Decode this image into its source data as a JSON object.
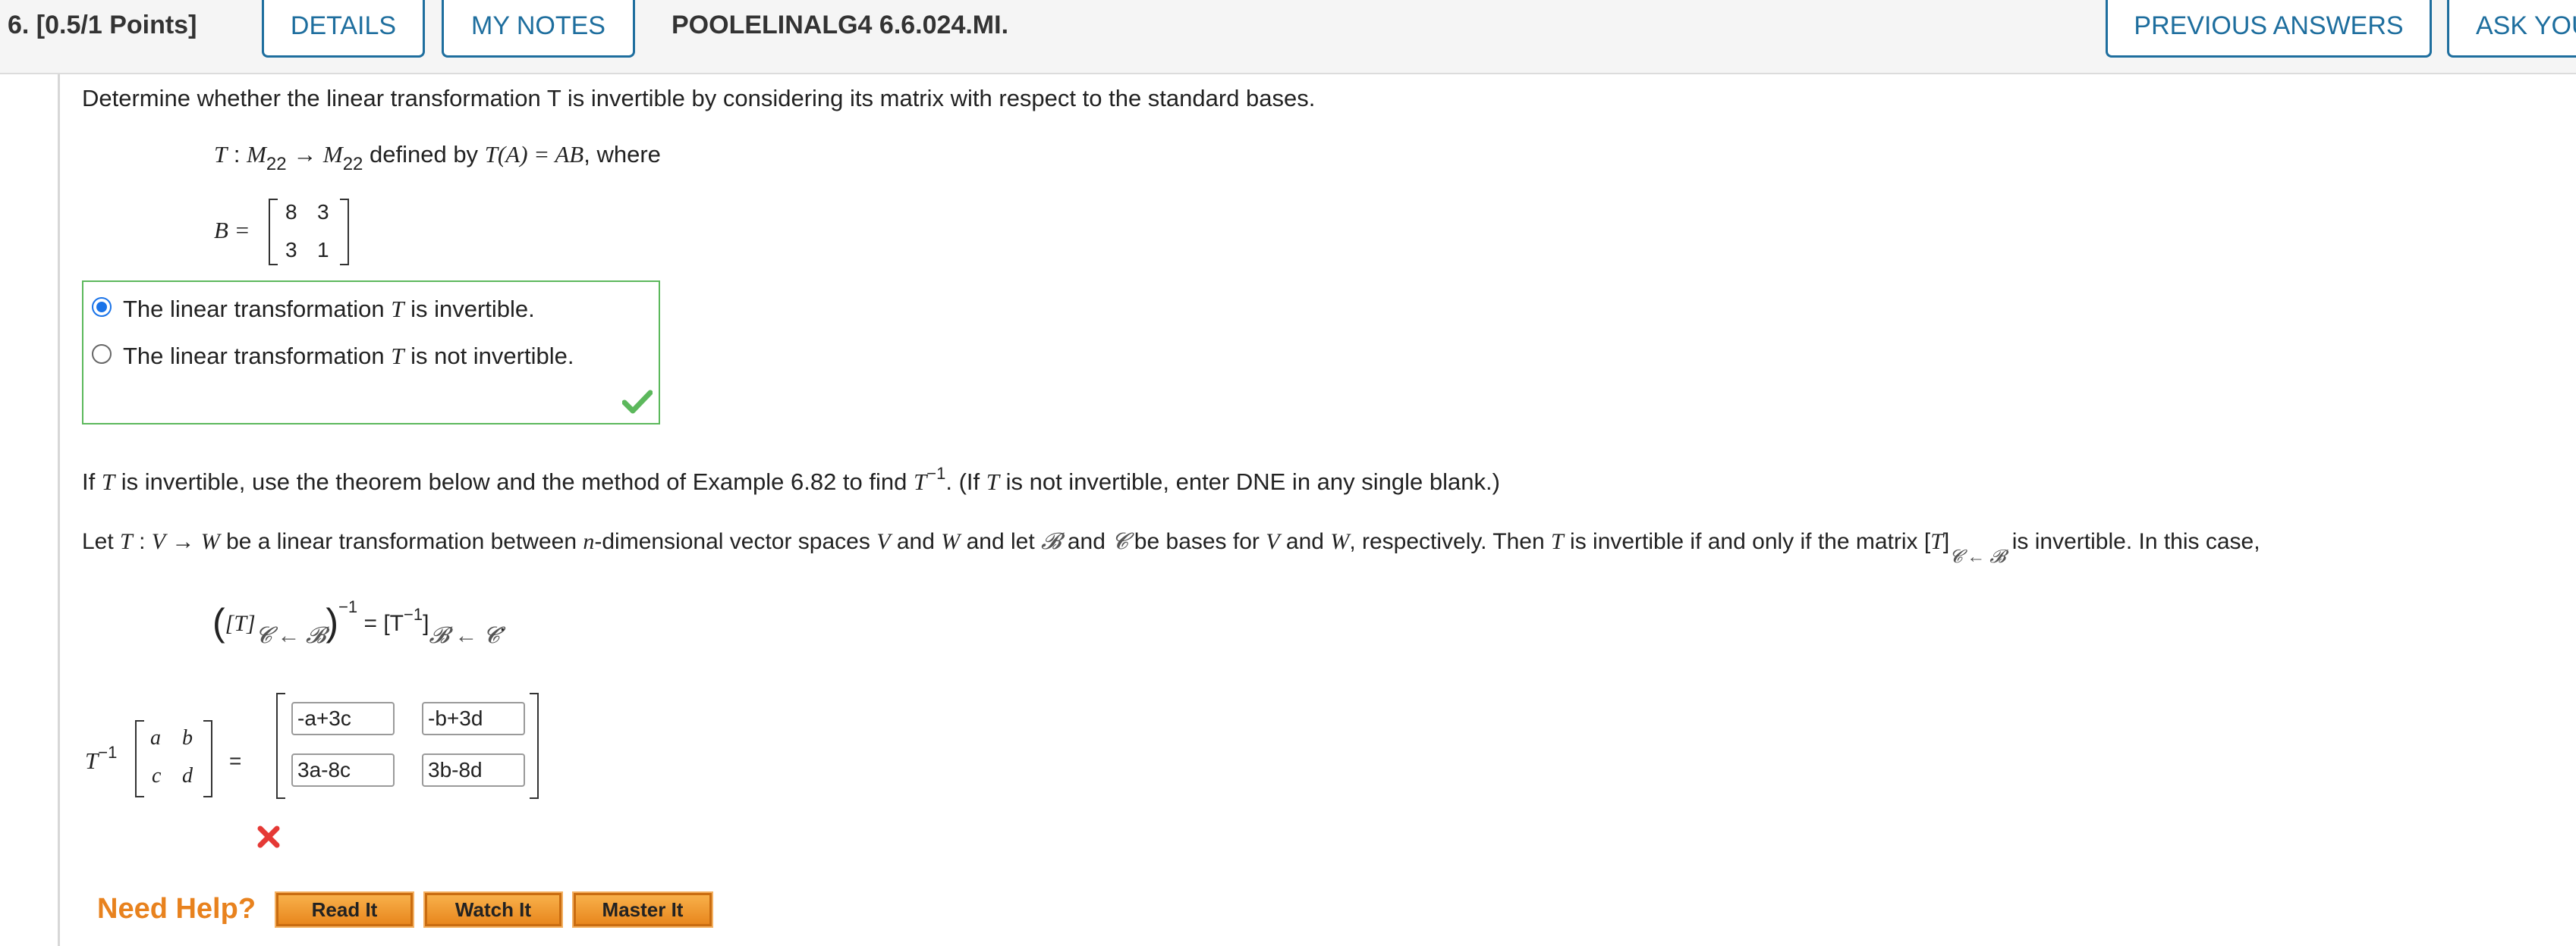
{
  "header": {
    "question_number": "6. [0.5/1 Points]",
    "details_label": "DETAILS",
    "my_notes_label": "MY NOTES",
    "problem_code": "POOLELINALG4 6.6.024.MI.",
    "previous_answers_label": "PREVIOUS ANSWERS",
    "ask_label": "ASK YOU"
  },
  "problem": {
    "intro": "Determine whether the linear transformation T is invertible by considering its matrix with respect to the standard bases.",
    "def_T": "T",
    "def_colon": " : ",
    "def_M1": "M",
    "def_sub1": "22",
    "def_arrow": " → ",
    "def_M2": "M",
    "def_sub2": "22",
    "def_text": " defined by ",
    "def_TA": "T(A) = AB",
    "def_where": ", where",
    "B_label": "B =",
    "matrix_B": [
      "8",
      "3",
      "3",
      "1"
    ]
  },
  "options": [
    {
      "prefix": "The linear transformation ",
      "var": "T",
      "suffix": " is invertible.",
      "selected": true
    },
    {
      "prefix": "The linear transformation ",
      "var": "T",
      "suffix": " is not invertible.",
      "selected": false
    }
  ],
  "part2": {
    "instruction_a": "If ",
    "instruction_T": "T",
    "instruction_b": " is invertible, use the theorem below and the method of Example 6.82 to find ",
    "instruction_Tinv": "T",
    "instruction_sup": "−1",
    "instruction_c": ". (If ",
    "instruction_T2": "T",
    "instruction_d": " is not invertible, enter DNE in any single blank.)",
    "theorem_a": "Let ",
    "theorem_T": "T",
    "theorem_b": " : ",
    "theorem_V": "V",
    "theorem_c": " → ",
    "theorem_W": "W",
    "theorem_d": " be a linear transformation between ",
    "theorem_n": "n",
    "theorem_e": "-dimensional vector spaces ",
    "theorem_V2": "V",
    "theorem_f": " and ",
    "theorem_W2": "W",
    "theorem_g": " and let ",
    "theorem_B": "𝓑",
    "theorem_h": " and ",
    "theorem_C": "𝓒",
    "theorem_i": " be bases for ",
    "theorem_V3": "V",
    "theorem_j": " and ",
    "theorem_W3": "W",
    "theorem_k": ", respectively. Then ",
    "theorem_T2": "T",
    "theorem_l": " is invertible if and only if the matrix [",
    "theorem_T3": "T",
    "theorem_m": "]",
    "theorem_sub": "𝓒 ← 𝓑",
    "theorem_n2": " is invertible. In this case,",
    "formula_left": "[T]",
    "formula_sub1": "𝓒 ← 𝓑",
    "formula_sup1": "−1",
    "formula_eq": " = [T",
    "formula_sup2": "−1",
    "formula_close": "]",
    "formula_sub2": "𝓑 ← 𝓒",
    "formula_dot": ".",
    "Tinv_label": "T",
    "Tinv_sup": "−1",
    "matrix_abcd": [
      "a",
      "b",
      "c",
      "d"
    ],
    "equals": "=",
    "answers": [
      "-a+3c",
      "-b+3d",
      "3a-8c",
      "3b-8d"
    ]
  },
  "help": {
    "need_help": "Need Help?",
    "read_it": "Read It",
    "watch_it": "Watch It",
    "master_it": "Master It"
  },
  "colors": {
    "accent": "#1e6e9e",
    "correct": "#5cb85c",
    "incorrect": "#e53935",
    "help_orange": "#e8821e"
  }
}
